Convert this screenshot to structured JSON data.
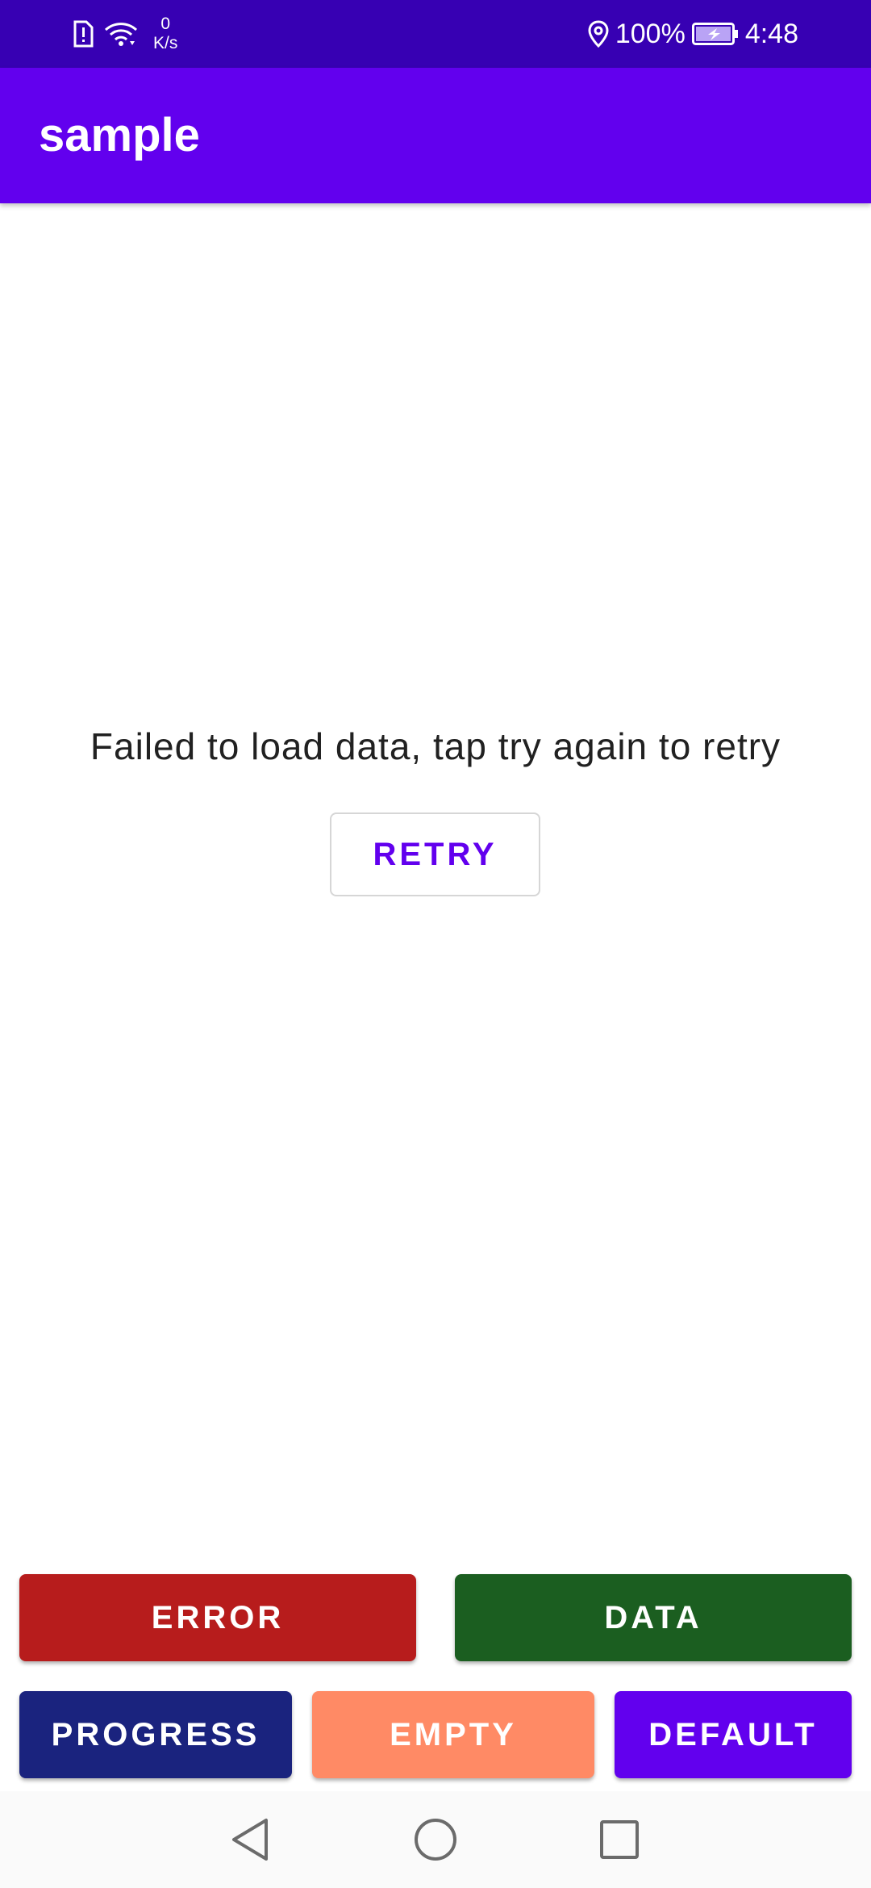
{
  "status_bar": {
    "netspeed_value": "0",
    "netspeed_unit": "K/s",
    "battery": "100%",
    "time": "4:48",
    "icons": [
      "sim-alert-icon",
      "wifi-icon",
      "location-icon",
      "battery-charging-icon"
    ]
  },
  "app_bar": {
    "title": "sample"
  },
  "error_state": {
    "message": "Failed to load data, tap try again to retry",
    "retry_label": "RETRY"
  },
  "state_buttons": {
    "error": "ERROR",
    "data": "DATA",
    "progress": "PROGRESS",
    "empty": "EMPTY",
    "default": "DEFAULT"
  },
  "nav_bar": {
    "icons": [
      "back-icon",
      "home-icon",
      "recents-icon"
    ]
  },
  "colors": {
    "status_bar": "#3700b3",
    "app_bar": "#6200ee",
    "retry_text": "#6200ee",
    "error_button": "#b71c1c",
    "data_button": "#1b5e20",
    "progress_button": "#1a237e",
    "empty_button": "#ff8a65",
    "default_button": "#6200ee"
  }
}
